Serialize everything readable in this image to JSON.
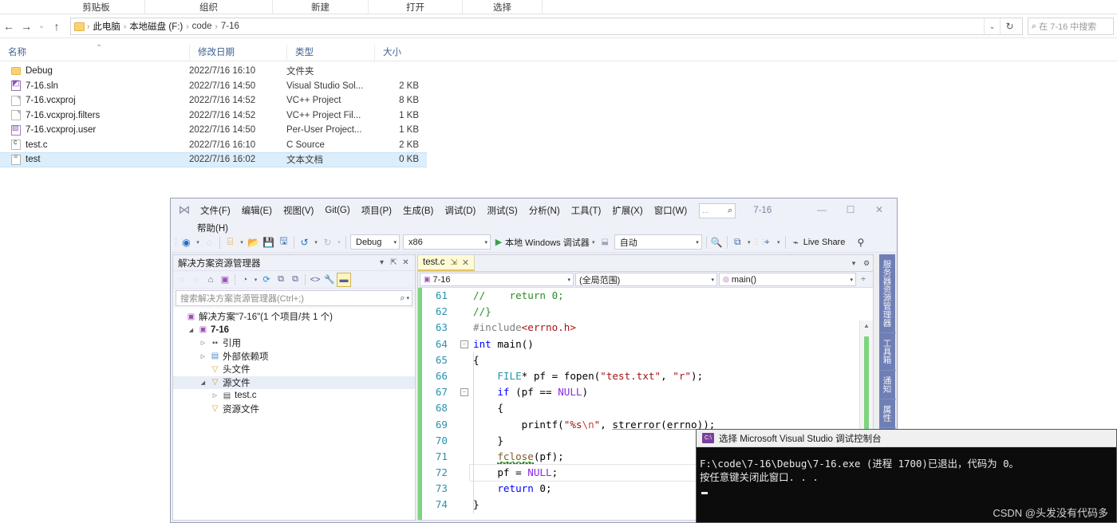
{
  "explorer": {
    "ribbon_tabs": [
      "剪贴板",
      "组织",
      "新建",
      "打开",
      "选择"
    ],
    "nav": {
      "back": "←",
      "forward": "→",
      "recent": "⌄",
      "up": "↑"
    },
    "breadcrumb": [
      "此电脑",
      "本地磁盘 (F:)",
      "code",
      "7-16"
    ],
    "path_caret": "⌄",
    "refresh": "↻",
    "search_placeholder": "在 7-16 中搜索",
    "search_icon": "⌕",
    "columns": [
      "名称",
      "修改日期",
      "类型",
      "大小"
    ],
    "sort_arrow": "⌃",
    "files": [
      {
        "icon": "folder",
        "name": "Debug",
        "date": "2022/7/16 16:10",
        "type": "文件夹",
        "size": "",
        "selected": false
      },
      {
        "icon": "sln",
        "name": "7-16.sln",
        "date": "2022/7/16 14:50",
        "type": "Visual Studio Sol...",
        "size": "2 KB",
        "selected": false
      },
      {
        "icon": "doc",
        "name": "7-16.vcxproj",
        "date": "2022/7/16 14:52",
        "type": "VC++ Project",
        "size": "8 KB",
        "selected": false
      },
      {
        "icon": "doc",
        "name": "7-16.vcxproj.filters",
        "date": "2022/7/16 14:52",
        "type": "VC++ Project Fil...",
        "size": "1 KB",
        "selected": false
      },
      {
        "icon": "user",
        "name": "7-16.vcxproj.user",
        "date": "2022/7/16 14:50",
        "type": "Per-User Project...",
        "size": "1 KB",
        "selected": false
      },
      {
        "icon": "c",
        "name": "test.c",
        "date": "2022/7/16 16:10",
        "type": "C Source",
        "size": "2 KB",
        "selected": false
      },
      {
        "icon": "txt",
        "name": "test",
        "date": "2022/7/16 16:02",
        "type": "文本文档",
        "size": "0 KB",
        "selected": true
      }
    ]
  },
  "vs": {
    "logo": "⋈",
    "menus_row1": [
      "文件(F)",
      "编辑(E)",
      "视图(V)",
      "Git(G)",
      "项目(P)",
      "生成(B)",
      "调试(D)",
      "测试(S)",
      "分析(N)",
      "工具(T)",
      "扩展(X)",
      "窗口(W)"
    ],
    "menus_row2": [
      "帮助(H)"
    ],
    "quick_search": {
      "dots": "...",
      "icon": "⌕"
    },
    "title": "7-16",
    "window_controls": {
      "minimize": "—",
      "maximize": "☐",
      "close": "✕"
    },
    "toolbar": {
      "nav_back": "◉",
      "nav_back_caret": "▾",
      "nav_forward": "◌",
      "new": "⌸",
      "new_caret": "▾",
      "open": "📂",
      "save": "💾",
      "save_all": "🖫",
      "undo": "↺",
      "undo_caret": "▾",
      "redo": "↻",
      "redo_caret": "▾",
      "config": "Debug",
      "platform": "x86",
      "play": "▶",
      "run_label": "本地 Windows 调试器",
      "run_caret": "▾",
      "proc_icon": "⬓",
      "proc_value": "自动",
      "find_icon": "🔍",
      "window_icon": "⧉",
      "ptr_icon": "⌖",
      "live_share_icon": "⌁",
      "live_share_label": "Live Share",
      "ext_icon": "⚲"
    },
    "solution_explorer": {
      "title": "解决方案资源管理器",
      "header_icons": {
        "dropdown": "▾",
        "pin": "⇱",
        "close": "✕"
      },
      "toolbar_icons": [
        "◌",
        "◌",
        "⌂",
        "⊞",
        "◔",
        "▾",
        "⟳",
        "⧉",
        "⧉",
        "<>",
        "🔧",
        "▬"
      ],
      "search_placeholder": "搜索解决方案资源管理器(Ctrl+;)",
      "search_icon": "⌕",
      "search_caret": "▾",
      "tree": [
        {
          "indent": 0,
          "twisty": "",
          "icon": "sln",
          "label": "解决方案\"7-16\"(1 个项目/共 1 个)",
          "bold": false,
          "selected": false
        },
        {
          "indent": 1,
          "twisty": "◢",
          "icon": "proj",
          "label": "7-16",
          "bold": true,
          "selected": false
        },
        {
          "indent": 2,
          "twisty": "▷",
          "icon": "ref",
          "label": "引用",
          "bold": false,
          "selected": false
        },
        {
          "indent": 2,
          "twisty": "▷",
          "icon": "ext",
          "label": "外部依赖项",
          "bold": false,
          "selected": false
        },
        {
          "indent": 2,
          "twisty": "",
          "icon": "filter",
          "label": "头文件",
          "bold": false,
          "selected": false
        },
        {
          "indent": 2,
          "twisty": "◢",
          "icon": "filter",
          "label": "源文件",
          "bold": false,
          "selected": true
        },
        {
          "indent": 3,
          "twisty": "▷",
          "icon": "cfile",
          "label": "test.c",
          "bold": false,
          "selected": false
        },
        {
          "indent": 2,
          "twisty": "",
          "icon": "filter",
          "label": "资源文件",
          "bold": false,
          "selected": false
        }
      ]
    },
    "editor": {
      "tab": {
        "label": "test.c",
        "pin": "⇲",
        "close": "✕"
      },
      "tabstrip_icons": {
        "dropdown": "▾",
        "settings": "⚙"
      },
      "nav": {
        "project_icon": "▣",
        "project": "7-16",
        "scope": "(全局范围)",
        "member_icon": "◎",
        "member": "main()",
        "split": "÷",
        "caret": "▾"
      },
      "first_line_number": 61,
      "lines": [
        {
          "n": 61,
          "fold": "",
          "text": "//    return 0;"
        },
        {
          "n": 62,
          "fold": "",
          "text": "//}"
        },
        {
          "n": 63,
          "fold": "",
          "text": "#include<errno.h>"
        },
        {
          "n": 64,
          "fold": "−",
          "text": "int main()"
        },
        {
          "n": 65,
          "fold": "",
          "text": "{"
        },
        {
          "n": 66,
          "fold": "",
          "text": "    FILE* pf = fopen(\"test.txt\", \"r\");"
        },
        {
          "n": 67,
          "fold": "−",
          "text": "    if (pf == NULL)"
        },
        {
          "n": 68,
          "fold": "",
          "text": "    {"
        },
        {
          "n": 69,
          "fold": "",
          "text": "        printf(\"%s\\n\", strerror(errno));"
        },
        {
          "n": 70,
          "fold": "",
          "text": "    }"
        },
        {
          "n": 71,
          "fold": "",
          "text": "    fclose(pf);"
        },
        {
          "n": 72,
          "fold": "",
          "text": "    pf = NULL;"
        },
        {
          "n": 73,
          "fold": "",
          "text": "    return 0;"
        },
        {
          "n": 74,
          "fold": "",
          "text": "}"
        }
      ],
      "scrollbar": {
        "up": "▲",
        "down": "▼"
      }
    },
    "vertical_tabs": [
      "服务器资源管理器",
      "工具箱",
      "通知",
      "属性"
    ]
  },
  "console": {
    "icon_label": "C:\\",
    "title": "选择 Microsoft Visual Studio 调试控制台",
    "line1": "F:\\code\\7-16\\Debug\\7-16.exe (进程 1700)已退出，代码为 0。",
    "line2": "按任意键关闭此窗口. . ."
  },
  "watermark": "CSDN @头发没有代码多",
  "colors": {
    "vs_chrome": "#eff1f8",
    "selection_blue": "#dceefb",
    "accent_tab": "#fffbd6",
    "change_bar_green": "#7ed47e",
    "vertical_tab_strip": "#6f7fb5",
    "console_bg": "#0c0c0c"
  }
}
